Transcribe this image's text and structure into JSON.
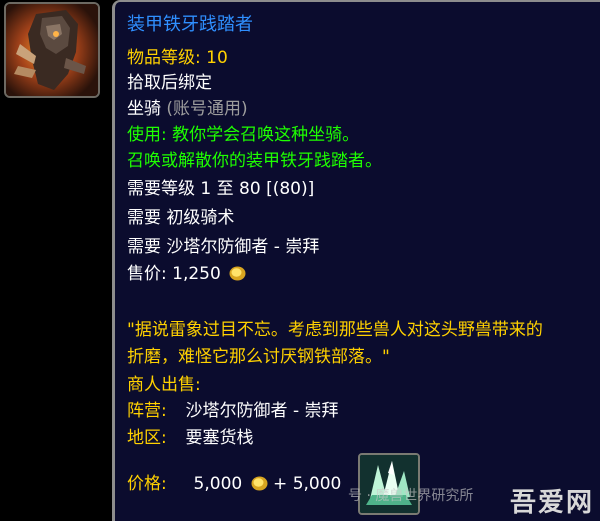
{
  "item": {
    "name": "装甲铁牙践踏者",
    "item_level_label": "物品等级:",
    "item_level_value": "10",
    "binding": "拾取后绑定",
    "type_label": "坐骑",
    "type_note": "(账号通用)",
    "use_text": "使用: 教你学会召唤这种坐骑。",
    "summon_text": "召唤或解散你的装甲铁牙践踏者。",
    "req_level": "需要等级 1 至 80 [(80)]",
    "req_skill": "需要 初级骑术",
    "req_faction": "需要 沙塔尔防御者 - 崇拜",
    "sell_price_label": "售价:",
    "sell_price_value": "1,250",
    "flavor_line1": "\"据说雷象过目不忘。考虑到那些兽人对这头野兽带来的",
    "flavor_line2": "折磨，难怪它那么讨厌钢铁部落。\"",
    "vendor_label": "商人出售:",
    "faction_label": "阵营:",
    "faction_value": "沙塔尔防御者 - 崇拜",
    "zone_label": "地区:",
    "zone_value": "要塞货栈",
    "price_label": "价格:",
    "price_gold": "5,000",
    "price_plus": "+",
    "price_currency": "5,000"
  },
  "watermark": {
    "text": "号 · 魔兽世界研究所",
    "corner": "吾爱网"
  },
  "colors": {
    "title": "#2f8fff",
    "yellow": "#ffd100",
    "green": "#1eff00",
    "gray": "#9d9d9d",
    "background": "#0b0c2e"
  },
  "icons": {
    "mount_icon": "armored-ironhoof-mount-icon",
    "gold_coin": "gold-coin-icon",
    "currency": "crystal-currency-icon"
  }
}
